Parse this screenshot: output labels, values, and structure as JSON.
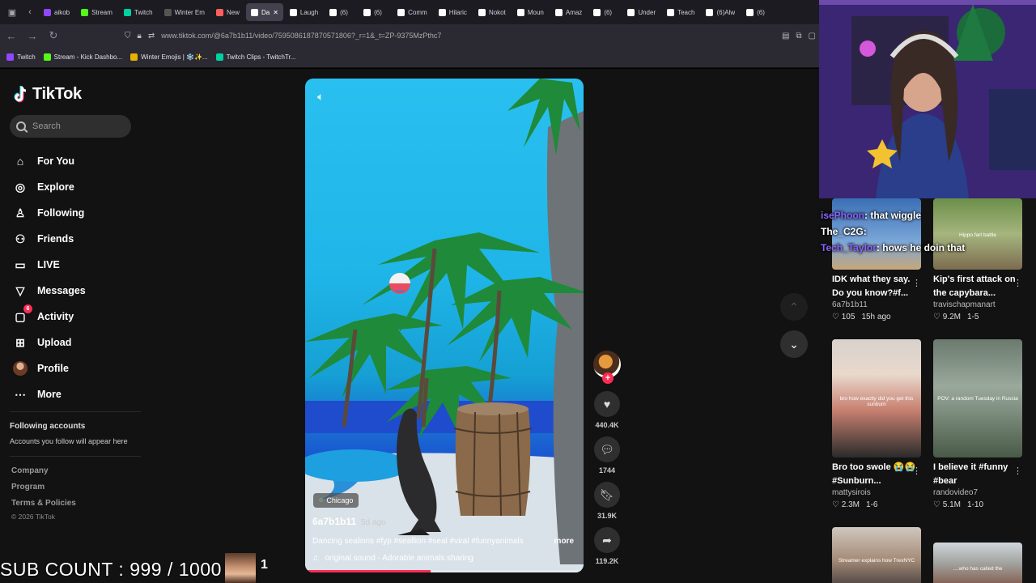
{
  "browser": {
    "tabs": [
      {
        "label": "aikob",
        "color": "#9146ff"
      },
      {
        "label": "Stream",
        "color": "#53fc18"
      },
      {
        "label": "Twitch",
        "color": "#00d1a0"
      },
      {
        "label": "Winter Em",
        "color": "#555555"
      },
      {
        "label": "New",
        "color": "#ff5e5e"
      },
      {
        "label": "Da",
        "color": "#ffffff",
        "active": true
      },
      {
        "label": "Laugh",
        "color": "#ffffff"
      },
      {
        "label": "(6)",
        "color": "#ffffff"
      },
      {
        "label": "(6)",
        "color": "#ffffff"
      },
      {
        "label": "Comm",
        "color": "#ffffff"
      },
      {
        "label": "Hilaric",
        "color": "#ffffff"
      },
      {
        "label": "Nokot",
        "color": "#ffffff"
      },
      {
        "label": "Moun",
        "color": "#ffffff"
      },
      {
        "label": "Amaz",
        "color": "#ffffff"
      },
      {
        "label": "(6)",
        "color": "#ffffff"
      },
      {
        "label": "Under",
        "color": "#ffffff"
      },
      {
        "label": "Teach",
        "color": "#ffffff"
      },
      {
        "label": "(6)Alw",
        "color": "#ffffff"
      },
      {
        "label": "(6)",
        "color": "#ffffff"
      }
    ],
    "url": "www.tiktok.com/@6a7b1b11/video/7595086187870571806?_r=1&_t=ZP-9375MzPthc7",
    "bookmarks": [
      {
        "label": "Twitch",
        "color": "#9146ff"
      },
      {
        "label": "Stream - Kick Dashbo...",
        "color": "#53fc18"
      },
      {
        "label": "Winter Emojis | ❄️✨...",
        "color": "#e8b000"
      },
      {
        "label": "Twitch Clips - TwitchTr...",
        "color": "#00d1a0"
      }
    ]
  },
  "tiktok": {
    "logo": "TikTok",
    "search_placeholder": "Search",
    "nav": [
      {
        "label": "For You",
        "icon": "home-icon"
      },
      {
        "label": "Explore",
        "icon": "compass-icon"
      },
      {
        "label": "Following",
        "icon": "person-check-icon"
      },
      {
        "label": "Friends",
        "icon": "friends-icon"
      },
      {
        "label": "LIVE",
        "icon": "live-icon"
      },
      {
        "label": "Messages",
        "icon": "messages-icon"
      },
      {
        "label": "Activity",
        "icon": "activity-icon",
        "badge": "6"
      },
      {
        "label": "Upload",
        "icon": "upload-icon"
      },
      {
        "label": "Profile",
        "icon": "avatar"
      },
      {
        "label": "More",
        "icon": "more-icon"
      }
    ],
    "following_title": "Following accounts",
    "following_sub": "Accounts you follow will appear here",
    "footer": [
      "Company",
      "Program",
      "Terms & Policies"
    ],
    "copyright": "© 2026 TikTok"
  },
  "video": {
    "location": "Chicago",
    "author": "6a7b1b11",
    "when": "5d ago",
    "caption": "Dancing sealions #fyp #seallion #seal #viral #funnyanimals",
    "more": "more",
    "sound": "original sound - Adorable animals sharing",
    "progress": 0.45,
    "likes": "440.4K",
    "comments": "1744",
    "saves": "31.9K",
    "shares": "119.2K"
  },
  "chat": [
    {
      "name": "isePhoon",
      "text": ": that wiggle"
    },
    {
      "name": "The_C2G",
      "text": ":"
    },
    {
      "name": "Tech_Taylor",
      "text": ": hows he doin that"
    }
  ],
  "related": [
    {
      "title": "IDK what they say. Do you know?#f...",
      "user": "6a7b1b11",
      "likes": "105",
      "when": "15h ago",
      "thumb_label": ""
    },
    {
      "title": "Kip's first attack on the capybara...",
      "user": "travischapmanart",
      "likes": "9.2M",
      "when": "1-5",
      "thumb_label": "Hippo fart battle"
    },
    {
      "title": "Bro too swole 😭😭 #Sunburn...",
      "user": "mattysirois",
      "likes": "2.3M",
      "when": "1-6",
      "thumb_label": "bro how exactly did you get this sunburn"
    },
    {
      "title": "I believe it #funny #bear",
      "user": "randovideo7",
      "likes": "5.1M",
      "when": "1-10",
      "thumb_label": "POV: a random Tuesday in Russia"
    },
    {
      "title": "",
      "user": "",
      "likes": "",
      "when": "",
      "thumb_label": "Streamer explains how TrexNYC"
    },
    {
      "title": "",
      "user": "",
      "likes": "",
      "when": "",
      "thumb_label": "....who has called the"
    }
  ],
  "overlay": {
    "sub_count": "SUB COUNT : 999 / 1000",
    "sub_rank": "1"
  }
}
